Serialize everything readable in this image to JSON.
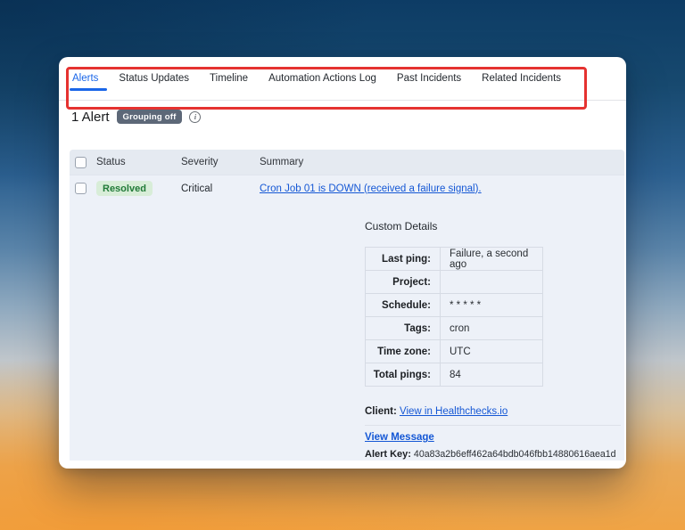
{
  "tabs": {
    "items": [
      {
        "label": "Alerts",
        "active": true
      },
      {
        "label": "Status Updates",
        "active": false
      },
      {
        "label": "Timeline",
        "active": false
      },
      {
        "label": "Automation Actions Log",
        "active": false
      },
      {
        "label": "Past Incidents",
        "active": false
      },
      {
        "label": "Related Incidents",
        "active": false
      }
    ]
  },
  "alerts_summary": {
    "count": "1 Alert",
    "grouping_badge": "Grouping off"
  },
  "icons": {
    "info": "i"
  },
  "alerts_table": {
    "columns": [
      "Status",
      "Severity",
      "Summary"
    ],
    "rows": [
      {
        "status": "Resolved",
        "severity": "Critical",
        "summary_link": "Cron Job 01 is DOWN (received a failure signal)."
      }
    ]
  },
  "custom_details": {
    "title": "Custom Details",
    "fields": [
      {
        "label": "Last ping:",
        "value": "Failure, a second ago"
      },
      {
        "label": "Project:",
        "value": ""
      },
      {
        "label": "Schedule:",
        "value": "* * * * *"
      },
      {
        "label": "Tags:",
        "value": "cron"
      },
      {
        "label": "Time zone:",
        "value": "UTC"
      },
      {
        "label": "Total pings:",
        "value": "84"
      }
    ],
    "client_label": "Client:",
    "client_link": "View in Healthchecks.io",
    "view_message_link": "View Message",
    "alert_key_label": "Alert Key:",
    "alert_key_value": "40a83a2b6eff462a64bdb046fbb14880616aea1d"
  },
  "colors": {
    "accent_blue": "#1a66e8",
    "link_blue": "#1457d5",
    "resolved_text": "#217a38",
    "resolved_bg": "#d8edd8",
    "annotation_red": "#e53230",
    "grouping_badge_bg": "#5d6878"
  }
}
